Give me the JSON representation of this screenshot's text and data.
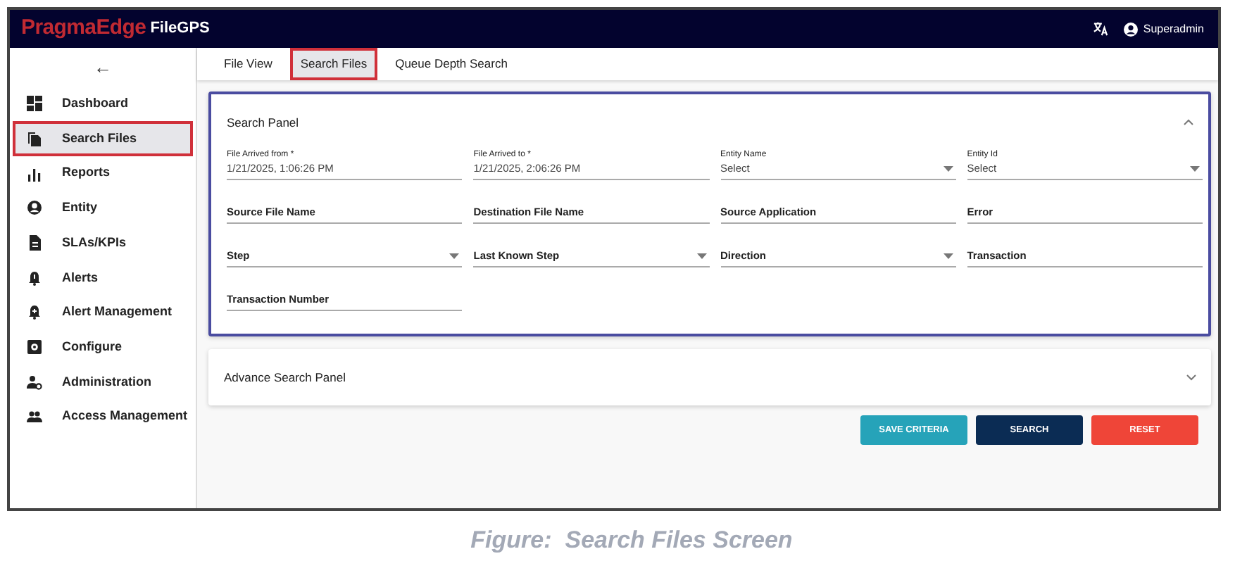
{
  "header": {
    "brand": "PragmaEdge",
    "product": "FileGPS",
    "user": "Superadmin"
  },
  "sidebar": {
    "back": "←",
    "items": [
      {
        "label": "Dashboard",
        "selected": false,
        "highlighted": false
      },
      {
        "label": "Search Files",
        "selected": true,
        "highlighted": true
      },
      {
        "label": "Reports",
        "selected": false,
        "highlighted": false
      },
      {
        "label": "Entity",
        "selected": false,
        "highlighted": false
      },
      {
        "label": "SLAs/KPIs",
        "selected": false,
        "highlighted": false
      },
      {
        "label": "Alerts",
        "selected": false,
        "highlighted": false
      },
      {
        "label": "Alert Management",
        "selected": false,
        "highlighted": false
      },
      {
        "label": "Configure",
        "selected": false,
        "highlighted": false
      },
      {
        "label": "Administration",
        "selected": false,
        "highlighted": false
      },
      {
        "label": "Access Management",
        "selected": false,
        "highlighted": false
      }
    ]
  },
  "tabs": [
    {
      "label": "File View",
      "selected": false,
      "highlighted": false
    },
    {
      "label": "Search Files",
      "selected": true,
      "highlighted": true
    },
    {
      "label": "Queue Depth Search",
      "selected": false,
      "highlighted": false
    }
  ],
  "search_panel": {
    "title": "Search Panel",
    "expanded": true,
    "highlighted": true,
    "fields": [
      {
        "label": "File Arrived from *",
        "value": "1/21/2025, 1:06:26 PM",
        "dropdown": false
      },
      {
        "label": "File Arrived to *",
        "value": "1/21/2025, 2:06:26 PM",
        "dropdown": false
      },
      {
        "label": "Entity Name",
        "value": "Select",
        "dropdown": true
      },
      {
        "label": "Entity Id",
        "value": "Select",
        "dropdown": true
      },
      {
        "placeholder": "Source File Name",
        "dropdown": false
      },
      {
        "placeholder": "Destination File Name",
        "dropdown": false
      },
      {
        "placeholder": "Source Application",
        "dropdown": false
      },
      {
        "placeholder": "Error",
        "dropdown": false
      },
      {
        "placeholder": "Step",
        "dropdown": true
      },
      {
        "placeholder": "Last Known Step",
        "dropdown": true
      },
      {
        "placeholder": "Direction",
        "dropdown": true
      },
      {
        "placeholder": "Transaction",
        "dropdown": false
      },
      {
        "placeholder": "Transaction Number",
        "dropdown": false
      }
    ]
  },
  "advance_panel": {
    "title": "Advance Search Panel",
    "expanded": false
  },
  "buttons": [
    {
      "label": "SAVE CRITERIA",
      "kind": "save"
    },
    {
      "label": "SEARCH",
      "kind": "search"
    },
    {
      "label": "RESET",
      "kind": "reset"
    }
  ],
  "caption": "Figure:  Search Files Screen"
}
